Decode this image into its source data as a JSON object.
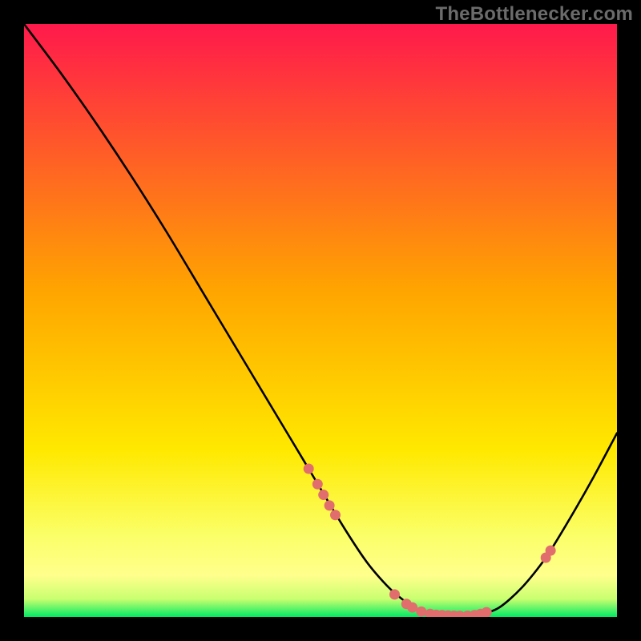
{
  "watermark": "TheBottlenecker.com",
  "chart_data": {
    "type": "line",
    "title": "",
    "xlabel": "",
    "ylabel": "",
    "xlim": [
      0,
      100
    ],
    "ylim": [
      0,
      100
    ],
    "x": [
      0,
      6,
      12,
      18,
      24,
      30,
      36,
      42,
      48,
      54,
      58,
      62,
      66,
      70,
      73,
      76,
      80,
      84,
      88,
      92,
      96,
      100
    ],
    "values": [
      100,
      92,
      83.5,
      74.5,
      65,
      55,
      45,
      35,
      25,
      15,
      9,
      4.5,
      1.5,
      0.4,
      0.1,
      0.2,
      1.5,
      5,
      10,
      16.5,
      23.5,
      31
    ],
    "marker_points": [
      {
        "x": 48.0,
        "y": 25.0
      },
      {
        "x": 49.5,
        "y": 22.4
      },
      {
        "x": 50.5,
        "y": 20.6
      },
      {
        "x": 51.5,
        "y": 18.8
      },
      {
        "x": 52.5,
        "y": 17.2
      },
      {
        "x": 62.5,
        "y": 3.8
      },
      {
        "x": 64.5,
        "y": 2.2
      },
      {
        "x": 65.5,
        "y": 1.6
      },
      {
        "x": 67.0,
        "y": 0.9
      },
      {
        "x": 68.5,
        "y": 0.5
      },
      {
        "x": 69.5,
        "y": 0.35
      },
      {
        "x": 70.5,
        "y": 0.3
      },
      {
        "x": 71.5,
        "y": 0.25
      },
      {
        "x": 72.5,
        "y": 0.2
      },
      {
        "x": 73.5,
        "y": 0.18
      },
      {
        "x": 74.8,
        "y": 0.2
      },
      {
        "x": 76.0,
        "y": 0.3
      },
      {
        "x": 77.0,
        "y": 0.5
      },
      {
        "x": 78.0,
        "y": 0.8
      },
      {
        "x": 88.0,
        "y": 10.0
      },
      {
        "x": 88.8,
        "y": 11.2
      }
    ],
    "colors": {
      "top": "#ff194c",
      "mid": "#ffe900",
      "bright_band_top": "#fbff66",
      "bright_band_mid": "#ffff8c",
      "bottom_edge": "#00ea63",
      "line": "#000000",
      "marker": "#e26d6d",
      "panel_bg": "#000000"
    }
  }
}
